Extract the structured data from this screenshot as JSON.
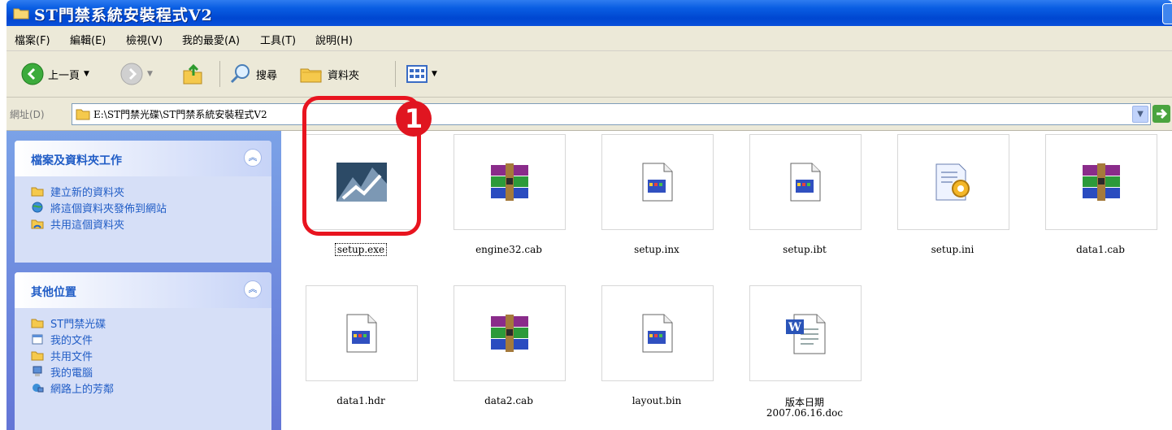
{
  "window": {
    "title": "ST門禁系統安裝程式V2"
  },
  "menu": [
    "檔案(F)",
    "編輯(E)",
    "檢視(V)",
    "我的最愛(A)",
    "工具(T)",
    "說明(H)"
  ],
  "toolbar": {
    "back_label": "上一頁",
    "search_label": "搜尋",
    "folders_label": "資料夾"
  },
  "address": {
    "label": "網址(D)",
    "path": "E:\\ST門禁光碟\\ST門禁系統安裝程式V2"
  },
  "left_panels": [
    {
      "title": "檔案及資料夾工作",
      "items": [
        "建立新的資料夾",
        "將這個資料夾發佈到網站",
        "共用這個資料夾"
      ]
    },
    {
      "title": "其他位置",
      "items": [
        "ST門禁光碟",
        "我的文件",
        "共用文件",
        "我的電腦",
        "網路上的芳鄰"
      ]
    }
  ],
  "files": [
    {
      "name": "setup.exe",
      "icon": "installer-exe-icon",
      "selected": true
    },
    {
      "name": "engine32.cab",
      "icon": "winrar-archive-icon"
    },
    {
      "name": "setup.inx",
      "icon": "generic-file-icon"
    },
    {
      "name": "setup.ibt",
      "icon": "generic-file-icon"
    },
    {
      "name": "setup.ini",
      "icon": "config-settings-icon"
    },
    {
      "name": "data1.cab",
      "icon": "winrar-archive-icon"
    },
    {
      "name": "data1.hdr",
      "icon": "generic-file-icon"
    },
    {
      "name": "data2.cab",
      "icon": "winrar-archive-icon"
    },
    {
      "name": "layout.bin",
      "icon": "generic-file-icon"
    },
    {
      "name": "版本日期",
      "name_line2": "2007.06.16.doc",
      "icon": "word-document-icon"
    }
  ],
  "annotation": {
    "number": "1",
    "color": "#e8141f"
  },
  "colors": {
    "titlebar": "#0a5ee3",
    "taskpane": "#6f8ee0",
    "link": "#215dc6"
  }
}
